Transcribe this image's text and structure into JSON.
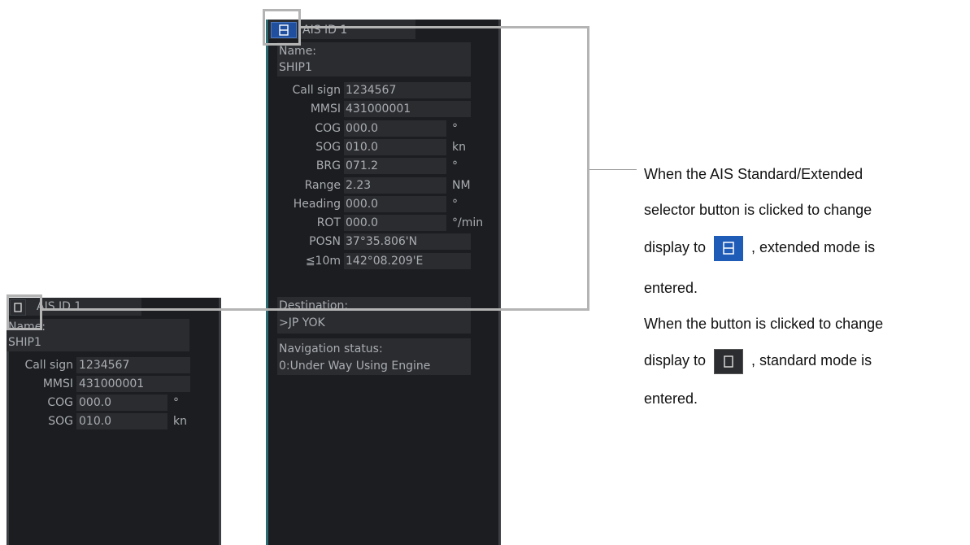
{
  "std_panel": {
    "title": "AIS ID 1",
    "name_label": "Name:",
    "name_value": "SHIP1",
    "rows": [
      {
        "label": "Call sign",
        "value": "1234567",
        "unit": ""
      },
      {
        "label": "MMSI",
        "value": "431000001",
        "unit": ""
      },
      {
        "label": "COG",
        "value": "000.0",
        "unit": "°"
      },
      {
        "label": "SOG",
        "value": "010.0",
        "unit": "kn"
      }
    ]
  },
  "ext_panel": {
    "title": "AIS ID 1",
    "name_label": "Name:",
    "name_value": "SHIP1",
    "rows": [
      {
        "label": "Call sign",
        "value": "1234567",
        "unit": ""
      },
      {
        "label": "MMSI",
        "value": "431000001",
        "unit": ""
      },
      {
        "label": "COG",
        "value": "000.0",
        "unit": "°"
      },
      {
        "label": "SOG",
        "value": "010.0",
        "unit": "kn"
      },
      {
        "label": "BRG",
        "value": "071.2",
        "unit": "°"
      },
      {
        "label": "Range",
        "value": "2.23",
        "unit": "NM"
      },
      {
        "label": "Heading",
        "value": "000.0",
        "unit": "°"
      },
      {
        "label": "ROT",
        "value": "000.0",
        "unit": "°/min"
      },
      {
        "label": "POSN",
        "value": "37°35.806'N",
        "unit": ""
      },
      {
        "label": "≦10m",
        "value": "142°08.209'E",
        "unit": ""
      }
    ],
    "destination_label": "Destination:",
    "destination_value": ">JP YOK",
    "nav_status_label": "Navigation status:",
    "nav_status_value": "0:Under Way Using Engine"
  },
  "description": {
    "line1": "When the AIS Standard/Extended",
    "line2": "selector button is clicked to change",
    "line3_pre": "display to",
    "line3_post": ", extended mode is",
    "line4": "entered.",
    "line5": "When the button is clicked to change",
    "line6_pre": "display to",
    "line6_post": ", standard mode is",
    "line7": "entered."
  },
  "colors": {
    "panel_bg": "#1b1d20",
    "field_bg": "#2a2c30",
    "text": "#a9acb1",
    "extended_button": "#1f5cb8",
    "highlight_frame": "#b4b4b4"
  },
  "icons": {
    "extended_mode": "split-rectangle-icon",
    "standard_mode": "empty-rectangle-icon"
  }
}
